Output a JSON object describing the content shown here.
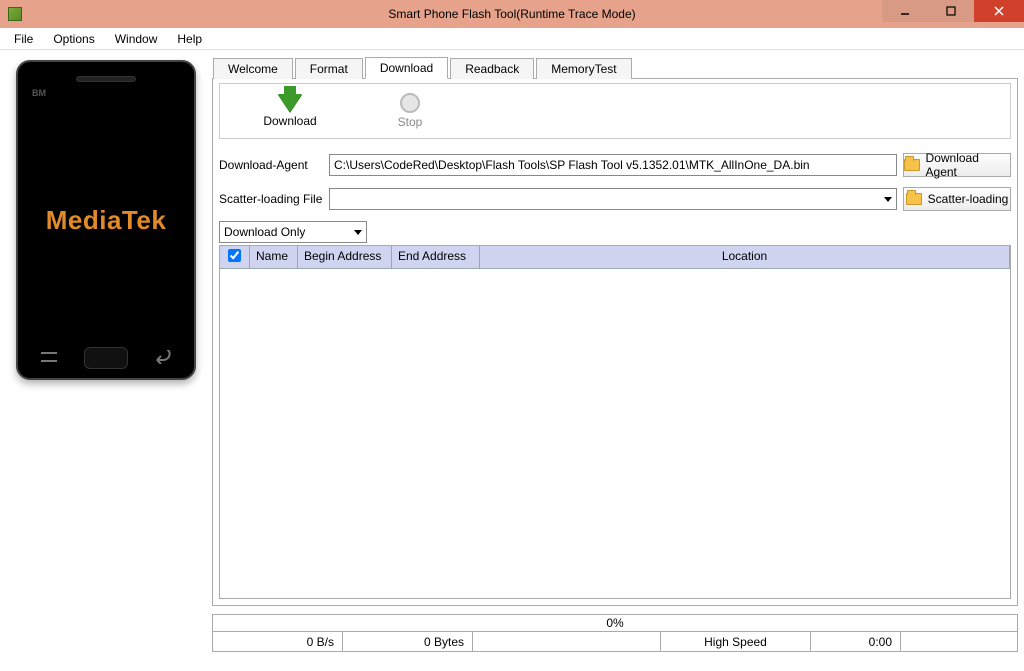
{
  "window": {
    "title": "Smart Phone Flash Tool(Runtime Trace Mode)"
  },
  "menu": {
    "file": "File",
    "options": "Options",
    "window": "Window",
    "help": "Help"
  },
  "tabs": {
    "welcome": "Welcome",
    "format": "Format",
    "download": "Download",
    "readback": "Readback",
    "memorytest": "MemoryTest",
    "active": "download"
  },
  "toolbar": {
    "download": "Download",
    "stop": "Stop"
  },
  "form": {
    "da_label": "Download-Agent",
    "da_value": "C:\\Users\\CodeRed\\Desktop\\Flash Tools\\SP Flash Tool v5.1352.01\\MTK_AllInOne_DA.bin",
    "da_button": "Download Agent",
    "scatter_label": "Scatter-loading File",
    "scatter_value": "",
    "scatter_button": "Scatter-loading",
    "mode": "Download Only"
  },
  "table": {
    "col_name": "Name",
    "col_begin": "Begin Address",
    "col_end": "End Address",
    "col_location": "Location"
  },
  "status": {
    "progress_text": "0%",
    "speed": "0 B/s",
    "bytes": "0 Bytes",
    "mode": "High Speed",
    "elapsed": "0:00"
  },
  "phone": {
    "bm": "BM",
    "brand": "MediaTek"
  }
}
